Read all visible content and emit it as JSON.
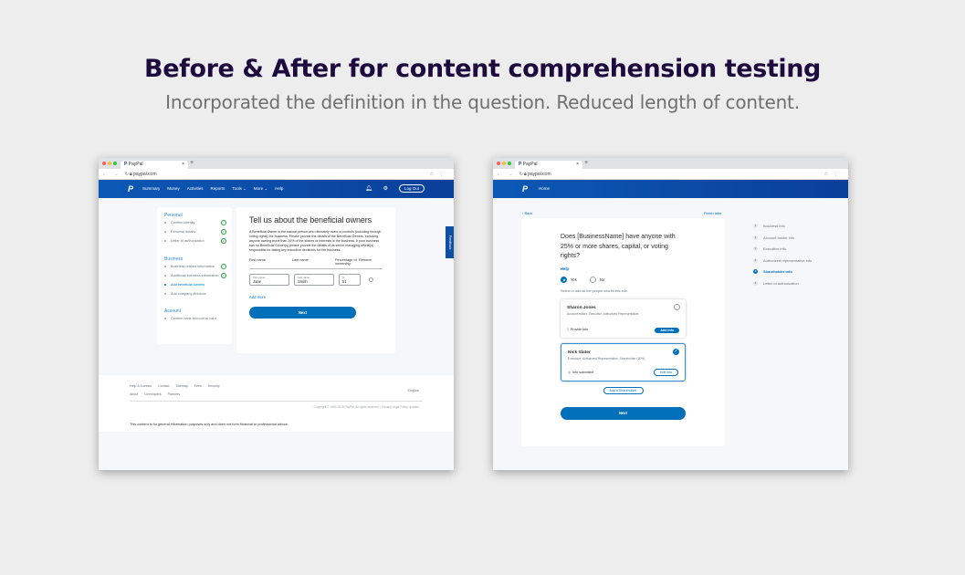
{
  "heading": "Before & After for content comprehension testing",
  "subheading": "Incorporated the definition in the question. Reduced length of content.",
  "colors": {
    "brand_blue": "#0070ba",
    "nav_blue": "#0a3f9a",
    "headline": "#1d0a3f",
    "success": "#2a9d3b"
  },
  "browser": {
    "tab_title": "PayPal",
    "url": "paypal.com"
  },
  "before": {
    "nav": {
      "links": [
        "Summary",
        "Money",
        "Activities",
        "Reports",
        "Tools ⌄",
        "More ⌄",
        "Help"
      ],
      "logout": "Log Out"
    },
    "sidebar": {
      "personal_label": "Personal",
      "personal_items": [
        "Confirm identity",
        "Personal details",
        "Letter of authorization"
      ],
      "business_label": "Business",
      "business_items": [
        "Business related information",
        "Additional business information",
        "Add beneficial owners",
        "Add company directors"
      ],
      "account_label": "Account",
      "account_items": [
        "Confirm bank account or card"
      ]
    },
    "card": {
      "title": "Tell us about the beneficial owners",
      "paragraph": "A Beneficial Owner is the natural person who ultimately owns or controls (including through voting rights) the business. Please provide the details of the Beneficial Owners, including anyone owning more than 25% of the shares or interests in the business. If your business has no Beneficial Owner(s) please provide the details of its senior managing official(s) responsible for taking key executive decisions for the business.",
      "col_first": "First name",
      "col_last": "Last name",
      "col_pct": "Percentage of ownership",
      "col_remove": "Remove",
      "first_label": "First name",
      "first_value": "Jane",
      "last_label": "Last name",
      "last_value": "Smith",
      "pct_label": "%",
      "pct_value": "51",
      "add_more": "Add more",
      "next": "Next"
    },
    "feedback_tab": "Feedback",
    "footer": {
      "links_row1": [
        "Help & Contact",
        "Contact",
        "Sitemap",
        "Fees",
        "Security"
      ],
      "links_row2": [
        "About",
        "Developers",
        "Partners"
      ],
      "language": "English",
      "copyright": "Copyright © 1999-2019 PayPal. All rights reserved.  |  Privacy  Legal  Policy updates",
      "disclaimer": "This content is for general information purposes only and does not form financial or professional advice."
    }
  },
  "after": {
    "nav": {
      "home": "Home"
    },
    "back": "‹ Back",
    "finish_later": "Finish later",
    "card": {
      "question": "Does [BusinessName] have anyone with 25% or more shares, capital, or voting rights?",
      "help": "Help",
      "yes": "Yes",
      "no": "No",
      "instruction": "Select or add all the people who fill this role.",
      "people": [
        {
          "name": "Sharon Jones",
          "roles": "Account holder, Executive, Authorized Representative",
          "status": "Provide info",
          "button": "Add info"
        },
        {
          "name": "Nick Slater",
          "roles": "Executive, Authorized Representative, Shareholder (30%)",
          "status": "Info submitted",
          "button": "Edit info"
        }
      ],
      "add_shareholder": "Add a Shareholder",
      "next": "Next"
    },
    "steps": [
      "Business info",
      "Account holder info",
      "Executive info",
      "Authorized representative info",
      "Shareholder info",
      "Letter of authorization"
    ]
  }
}
